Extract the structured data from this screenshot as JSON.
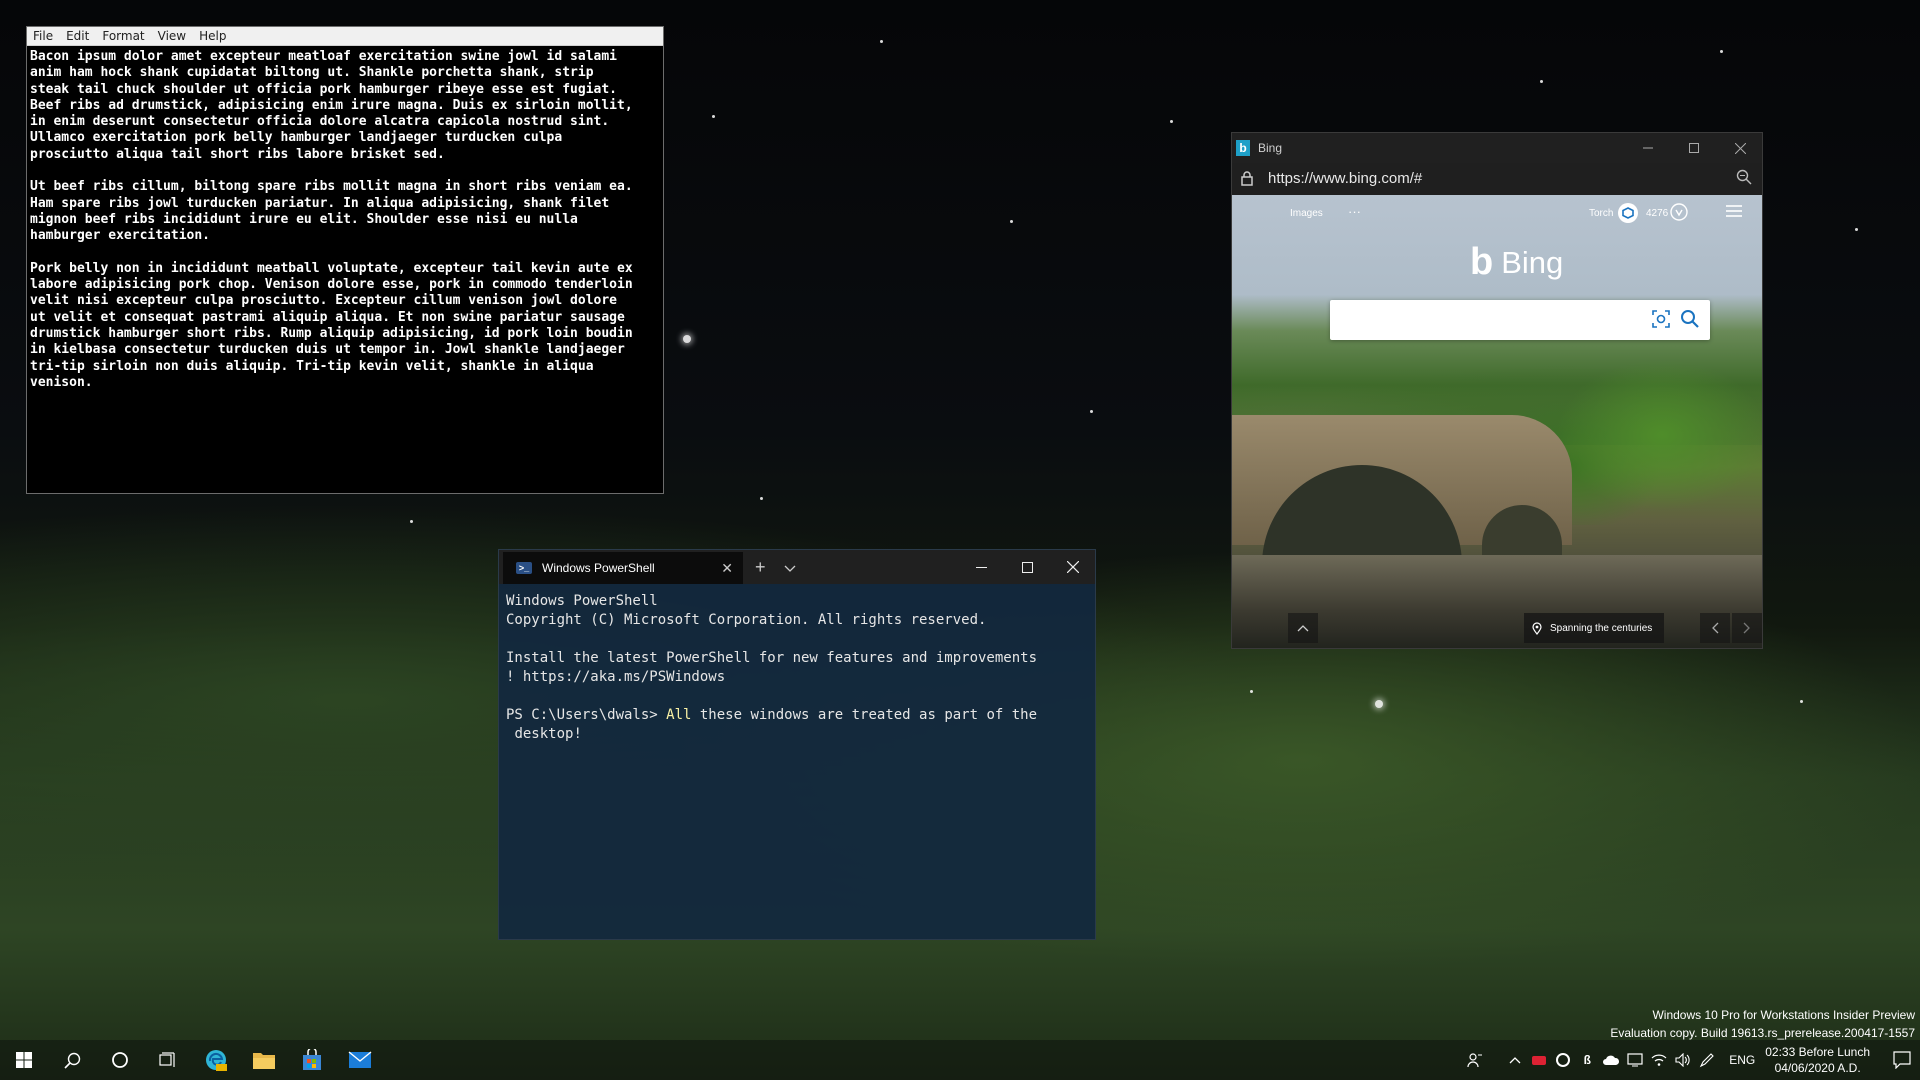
{
  "notepad": {
    "menu": [
      "File",
      "Edit",
      "Format",
      "View",
      "Help"
    ],
    "text": "Bacon ipsum dolor amet excepteur meatloaf exercitation swine jowl id salami\nanim ham hock shank cupidatat biltong ut. Shankle porchetta shank, strip\nsteak tail chuck shoulder ut officia pork hamburger ribeye esse est fugiat.\nBeef ribs ad drumstick, adipisicing enim irure magna. Duis ex sirloin mollit,\nin enim deserunt consectetur officia dolore alcatra capicola nostrud sint.\nUllamco exercitation pork belly hamburger landjaeger turducken culpa\nprosciutto aliqua tail short ribs labore brisket sed.\n\nUt beef ribs cillum, biltong spare ribs mollit magna in short ribs veniam ea.\nHam spare ribs jowl turducken pariatur. In aliqua adipisicing, shank filet\nmignon beef ribs incididunt irure eu elit. Shoulder esse nisi eu nulla\nhamburger exercitation.\n\nPork belly non in incididunt meatball voluptate, excepteur tail kevin aute ex\nlabore adipisicing pork chop. Venison dolore esse, pork in commodo tenderloin\nvelit nisi excepteur culpa prosciutto. Excepteur cillum venison jowl dolore\nut velit et consequat pastrami aliquip aliqua. Et non swine pariatur sausage\ndrumstick hamburger short ribs. Rump aliquip adipisicing, id pork loin boudin\nin kielbasa consectetur turducken duis ut tempor in. Jowl shankle landjaeger\ntri-tip sirloin non duis aliquip. Tri-tip kevin velit, shankle in aliqua\nvenison."
  },
  "bing": {
    "title": "Bing",
    "url": "https://www.bing.com/#",
    "nav_images": "Images",
    "nav_more": "···",
    "user_name": "Torch",
    "points": "4276",
    "logo_text": "Bing",
    "search_value": "",
    "caption": "Spanning the centuries",
    "icons": {
      "favicon": "bing-logo-icon",
      "lock": "lock-icon",
      "zoom": "zoom-icon",
      "visual_search": "camera-icon",
      "search": "magnifier-icon"
    }
  },
  "terminal": {
    "tab_title": "Windows PowerShell",
    "lines": {
      "l1": "Windows PowerShell",
      "l2": "Copyright (C) Microsoft Corporation. All rights reserved.",
      "l3": "Install the latest PowerShell for new features and improvements",
      "l4": "! https://aka.ms/PSWindows",
      "prompt": "PS C:\\Users\\dwals> ",
      "cmd_all": "All",
      "cmd_rest": " these windows are treated as part of the",
      "cmd_cont": " desktop!"
    }
  },
  "watermark": {
    "line1": "Windows 10 Pro for Workstations Insider Preview",
    "line2": "Evaluation copy. Build 19613.rs_prerelease.200417-1557"
  },
  "taskbar": {
    "lang": "ENG",
    "time": "02:33 Before Lunch",
    "date": "04/06/2020 A.D.",
    "colors": {
      "edge": "#2fb5d6",
      "folder": "#e8b84a",
      "store": "#3a86d4",
      "mail": "#1b7dd9",
      "start": "#ffffff"
    }
  }
}
